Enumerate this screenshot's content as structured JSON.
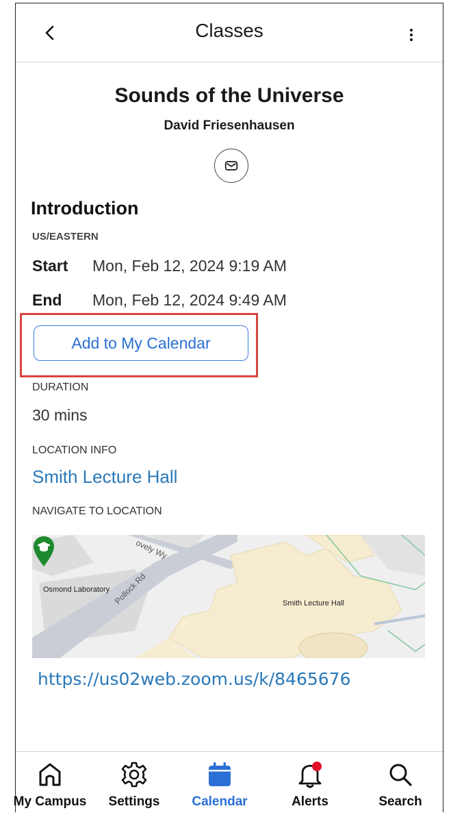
{
  "header": {
    "title": "Classes"
  },
  "course": {
    "title": "Sounds of the Universe",
    "instructor": "David Friesenhausen"
  },
  "session": {
    "title": "Introduction",
    "timezone": "US/EASTERN",
    "start_label": "Start",
    "start_value": "Mon, Feb 12, 2024 9:19 AM",
    "end_label": "End",
    "end_value": "Mon, Feb 12, 2024 9:49 AM",
    "add_calendar_label": "Add to My Calendar"
  },
  "duration": {
    "label": "DURATION",
    "value": "30 mins"
  },
  "location": {
    "label": "LOCATION INFO",
    "name": "Smith Lecture Hall",
    "navigate_label": "NAVIGATE TO LOCATION"
  },
  "map": {
    "labels": {
      "osmond": "Osmond Laboratory",
      "smith": "Smith Lecture Hall",
      "pollock": "Pollock Rd",
      "lovely": "ovely Wy"
    }
  },
  "meeting_link": "https://us02web.zoom.us/k/8465676",
  "tabs": [
    {
      "label": "My Campus",
      "icon": "home-icon"
    },
    {
      "label": "Settings",
      "icon": "gear-icon"
    },
    {
      "label": "Calendar",
      "icon": "calendar-icon",
      "active": true
    },
    {
      "label": "Alerts",
      "icon": "bell-icon",
      "badge": true
    },
    {
      "label": "Search",
      "icon": "search-icon"
    }
  ],
  "colors": {
    "accent": "#2a6fd6",
    "link": "#2a78b8",
    "highlight": "#d9443c",
    "badge": "#e0102a",
    "pin": "#1e8a2e"
  }
}
